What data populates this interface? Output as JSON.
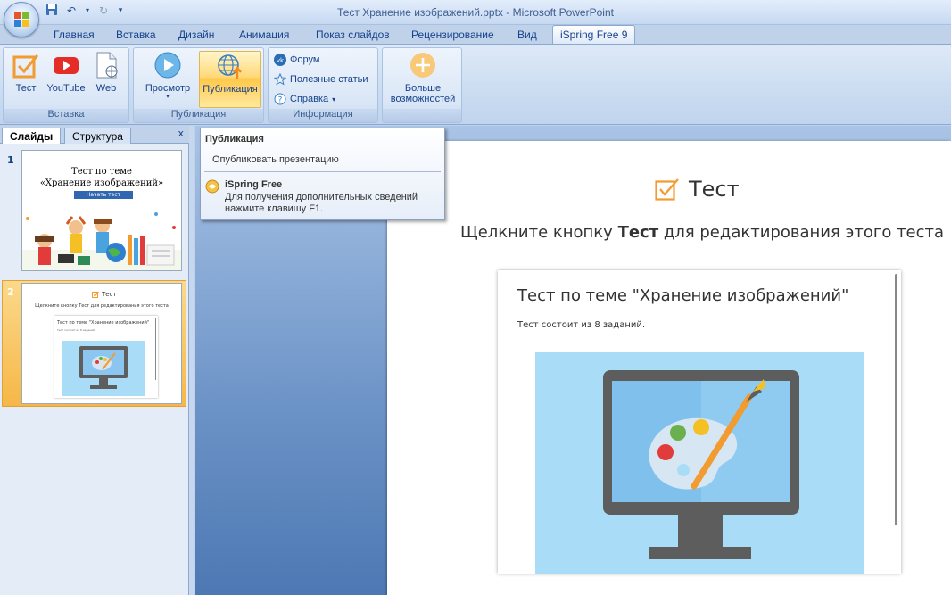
{
  "window": {
    "title": "Тест Хранение изображений.pptx - Microsoft PowerPoint"
  },
  "tabs": [
    {
      "label": "Главная",
      "active": false
    },
    {
      "label": "Вставка",
      "active": false
    },
    {
      "label": "Дизайн",
      "active": false
    },
    {
      "label": "Анимация",
      "active": false
    },
    {
      "label": "Показ слайдов",
      "active": false
    },
    {
      "label": "Рецензирование",
      "active": false
    },
    {
      "label": "Вид",
      "active": false
    },
    {
      "label": "iSpring Free 9",
      "active": true
    }
  ],
  "ribbon": {
    "groups": {
      "insert": {
        "label": "Вставка",
        "buttons": [
          "Тест",
          "YouTube",
          "Web"
        ]
      },
      "publish": {
        "label": "Публикация",
        "preview": "Просмотр",
        "publish": "Публикация"
      },
      "info": {
        "label": "Информация",
        "forum": "Форум",
        "articles": "Полезные статьи",
        "help": "Справка"
      },
      "more": {
        "line1": "Больше",
        "line2": "возможностей"
      }
    }
  },
  "left_pane": {
    "tab_slides": "Слайды",
    "tab_outline": "Структура",
    "close": "x",
    "slides": [
      {
        "number": "1",
        "title_line1": "Тест по теме",
        "title_line2": "«Хранение изображений»",
        "button": "Начать тест"
      },
      {
        "number": "2",
        "title": "Тест",
        "subtitle": "Щелкните кнопку Тест для редактирования этого теста",
        "card_title": "Тест по теме \"Хранение изображений\"",
        "card_desc": "Тест состоит из 8 заданий."
      }
    ]
  },
  "tooltip": {
    "title": "Публикация",
    "description": "Опубликовать презентацию",
    "footer_title": "iSpring Free",
    "footer_desc": "Для получения дополнительных сведений нажмите клавишу F1."
  },
  "slide": {
    "title": "Тест",
    "subtitle_pre": "Щелкните кнопку ",
    "subtitle_bold": "Тест",
    "subtitle_post": " для редактирования  этого теста",
    "quiz_title": "Тест по теме \"Хранение изображений\"",
    "quiz_desc": "Тест состоит из 8 заданий."
  },
  "colors": {
    "accent_orange": "#f29b30",
    "youtube_red": "#e52d27",
    "ribbon_text": "#15428b"
  }
}
